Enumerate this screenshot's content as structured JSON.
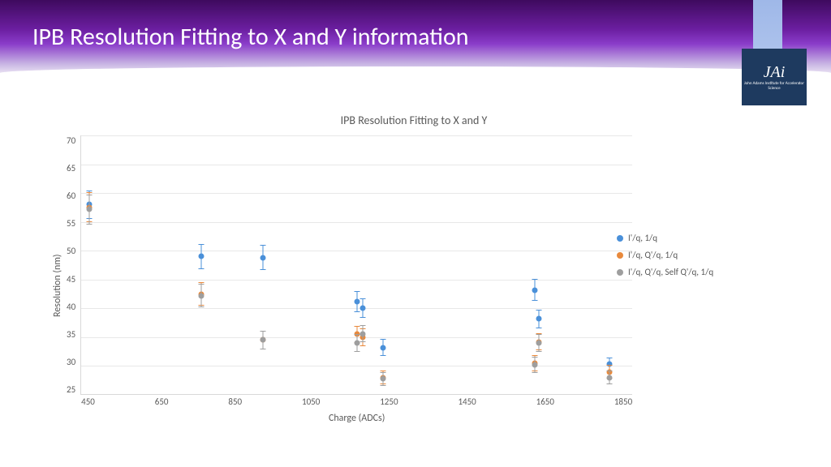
{
  "title": "IPB Resolution Fitting to X and Y information",
  "logo": {
    "main": "JAi",
    "sub": "John Adams Institute for Accelerator Science"
  },
  "chart_data": {
    "type": "scatter",
    "title": "IPB Resolution Fitting to X and Y",
    "xlabel": "Charge (ADCs)",
    "ylabel": "Resolution (nm)",
    "xlim": [
      450,
      1850
    ],
    "ylim": [
      25,
      70
    ],
    "xticks": [
      450,
      650,
      850,
      1050,
      1250,
      1450,
      1650,
      1850
    ],
    "yticks": [
      25,
      30,
      35,
      40,
      45,
      50,
      55,
      60,
      65,
      70
    ],
    "series": [
      {
        "name": "I'/q, 1/q",
        "color": "#4a90d9",
        "points": [
          {
            "x": 470,
            "y": 58.0,
            "err": 2.5
          },
          {
            "x": 755,
            "y": 49.0,
            "err": 2.2
          },
          {
            "x": 910,
            "y": 48.8,
            "err": 2.2
          },
          {
            "x": 1150,
            "y": 41.2,
            "err": 1.8
          },
          {
            "x": 1165,
            "y": 40.0,
            "err": 1.7
          },
          {
            "x": 1215,
            "y": 33.2,
            "err": 1.5
          },
          {
            "x": 1600,
            "y": 43.2,
            "err": 1.9
          },
          {
            "x": 1610,
            "y": 38.2,
            "err": 1.6
          },
          {
            "x": 1790,
            "y": 30.3,
            "err": 1.2
          }
        ]
      },
      {
        "name": "I'/q, Q'/q, 1/q",
        "color": "#e8893c",
        "points": [
          {
            "x": 470,
            "y": 57.5,
            "err": 2.6
          },
          {
            "x": 755,
            "y": 42.5,
            "err": 2.0
          },
          {
            "x": 910,
            "y": 34.5,
            "err": 1.6
          },
          {
            "x": 1150,
            "y": 35.5,
            "err": 1.5
          },
          {
            "x": 1165,
            "y": 35.0,
            "err": 1.5
          },
          {
            "x": 1215,
            "y": 28.0,
            "err": 1.2
          },
          {
            "x": 1600,
            "y": 30.5,
            "err": 1.4
          },
          {
            "x": 1610,
            "y": 34.2,
            "err": 1.5
          },
          {
            "x": 1790,
            "y": 29.0,
            "err": 1.2
          }
        ]
      },
      {
        "name": "I'/q, Q'/q, Self Q'/q, 1/q",
        "color": "#9e9e9e",
        "points": [
          {
            "x": 470,
            "y": 57.2,
            "err": 2.6
          },
          {
            "x": 755,
            "y": 42.2,
            "err": 2.0
          },
          {
            "x": 910,
            "y": 34.5,
            "err": 1.6
          },
          {
            "x": 1150,
            "y": 34.0,
            "err": 1.5
          },
          {
            "x": 1165,
            "y": 35.6,
            "err": 1.5
          },
          {
            "x": 1215,
            "y": 27.8,
            "err": 1.2
          },
          {
            "x": 1600,
            "y": 30.2,
            "err": 1.4
          },
          {
            "x": 1610,
            "y": 34.0,
            "err": 1.5
          },
          {
            "x": 1790,
            "y": 28.0,
            "err": 1.2
          }
        ]
      }
    ]
  }
}
